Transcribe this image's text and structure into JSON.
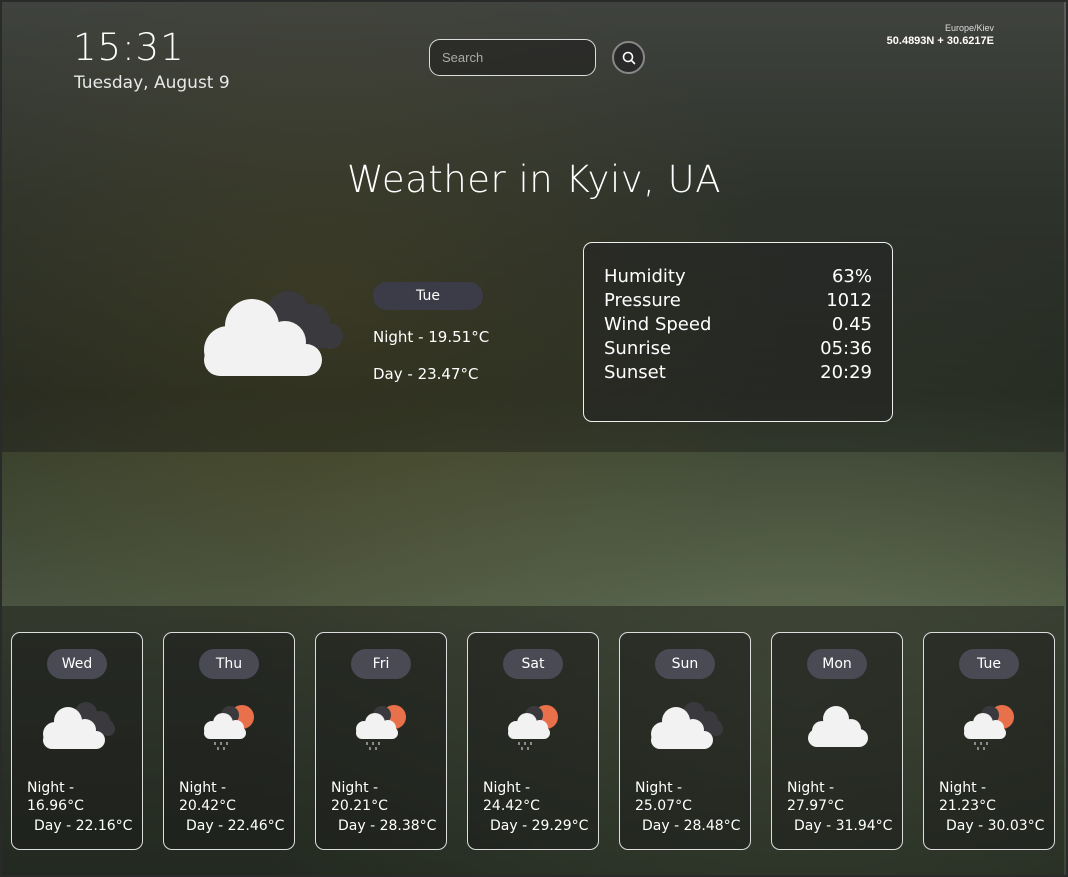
{
  "clock": {
    "time": "15:31",
    "date": "Tuesday, August 9"
  },
  "search": {
    "placeholder": "Search"
  },
  "location": {
    "timezone": "Europe/Kiev",
    "coords": "50.4893N + 30.6217E"
  },
  "title": "Weather in Kyiv, UA",
  "current": {
    "day": "Tue",
    "icon": "cloud-icon",
    "night": "Night - 19.51°C",
    "day_temp": "Day - 23.47°C"
  },
  "details": [
    {
      "label": "Humidity",
      "value": "63%"
    },
    {
      "label": "Pressure",
      "value": "1012"
    },
    {
      "label": "Wind Speed",
      "value": "0.45"
    },
    {
      "label": "Sunrise",
      "value": "05:36"
    },
    {
      "label": "Sunset",
      "value": "20:29"
    }
  ],
  "forecast": [
    {
      "day": "Wed",
      "icon": "cloud-icon",
      "night": "Night -",
      "night_temp": "16.96°C",
      "day_temp": "Day - 22.16°C"
    },
    {
      "day": "Thu",
      "icon": "sun-cloud-rain-icon",
      "night": "Night -",
      "night_temp": "20.42°C",
      "day_temp": "Day - 22.46°C"
    },
    {
      "day": "Fri",
      "icon": "sun-cloud-rain-icon",
      "night": "Night -",
      "night_temp": "20.21°C",
      "day_temp": "Day - 28.38°C"
    },
    {
      "day": "Sat",
      "icon": "sun-cloud-rain-icon",
      "night": "Night -",
      "night_temp": "24.42°C",
      "day_temp": "Day - 29.29°C"
    },
    {
      "day": "Sun",
      "icon": "cloud-icon",
      "night": "Night -",
      "night_temp": "25.07°C",
      "day_temp": "Day - 28.48°C"
    },
    {
      "day": "Mon",
      "icon": "white-cloud-icon",
      "night": "Night -",
      "night_temp": "27.97°C",
      "day_temp": "Day - 31.94°C"
    },
    {
      "day": "Tue",
      "icon": "sun-cloud-rain-icon",
      "night": "Night -",
      "night_temp": "21.23°C",
      "day_temp": "Day - 30.03°C"
    }
  ]
}
